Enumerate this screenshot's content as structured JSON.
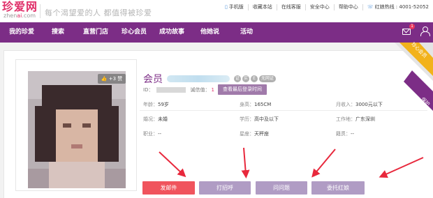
{
  "header": {
    "logo_cn": "珍爱网",
    "logo_en_prefix": "zhen",
    "logo_en_accent": "ai",
    "logo_en_suffix": ".com",
    "slogan": "每个渴望爱的人  都值得被珍爱",
    "links": {
      "mobile": "手机版",
      "favorite": "收藏本站",
      "support": "在线客服",
      "safety": "安全中心",
      "help": "帮助中心",
      "hotline_label": "红娘热线 : ",
      "hotline_number": "4001-52052"
    }
  },
  "nav": {
    "items": [
      "我的珍爱",
      "搜索",
      "直营门店",
      "珍心会员",
      "成功故事",
      "他她说",
      "活动"
    ],
    "mail_count": "1"
  },
  "profile": {
    "name": "会员",
    "verify_icons": [
      "证",
      "实",
      "E",
      "无网证"
    ],
    "likes": "+3 赞",
    "id_label": "ID：",
    "credit_label": "诚信值：",
    "credit_value": "1",
    "last_login_button": "查看最后登录时间",
    "info": {
      "age_label": "年龄：",
      "age": "59岁",
      "height_label": "身高：",
      "height": "165CM",
      "income_label": "月收入：",
      "income": "3000元以下",
      "marriage_label": "婚况：",
      "marriage": "未婚",
      "education_label": "学历：",
      "education": "高中及以下",
      "workplace_label": "工作地：",
      "workplace": "广东深圳",
      "job_label": "职业：",
      "job": "--",
      "zodiac_label": "星座：",
      "zodiac": "天秤座",
      "hometown_label": "籍贯：",
      "hometown": "--"
    }
  },
  "actions": {
    "send_mail": "发邮件",
    "greet": "打招呼",
    "ask": "问问题",
    "matchmaker": "委托红娘"
  },
  "ribbon": {
    "top_text": "珍心会员",
    "bottom_text": "保护"
  },
  "colors": {
    "brand_purple": "#7c2d86",
    "brand_pink": "#e0306a",
    "primary_action": "#f0545d",
    "secondary_action": "#b09cc4",
    "arrow": "#e8283c"
  }
}
